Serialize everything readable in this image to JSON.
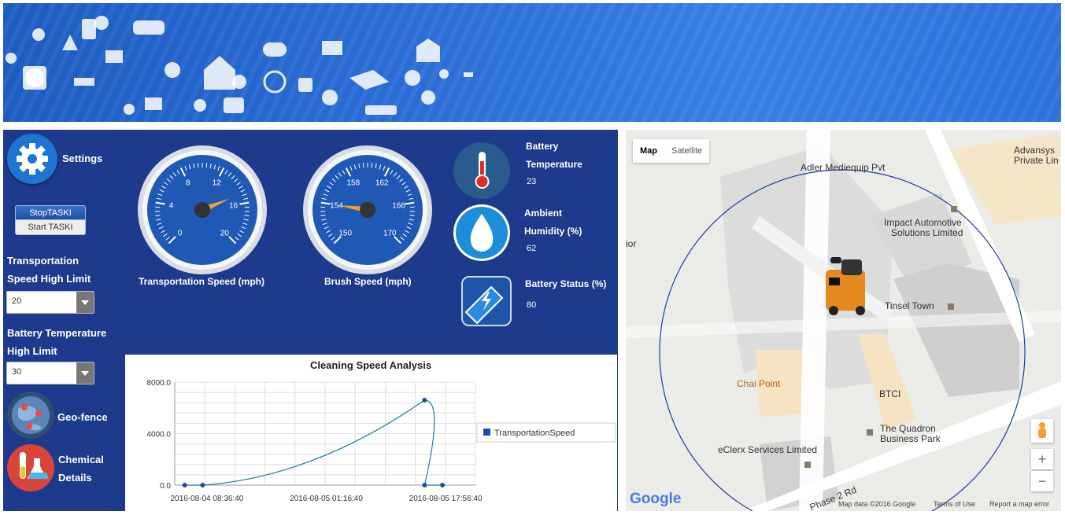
{
  "sidebar": {
    "settings_label": "Settings",
    "stop_task_label": "StopTASKI",
    "start_task_label": "Start TASKI",
    "transport_limit_label_1": "Transportation",
    "transport_limit_label_2": "Speed High Limit",
    "transport_limit_value": "20",
    "battery_limit_label_1": "Battery Temperature",
    "battery_limit_label_2": "High Limit",
    "battery_limit_value": "30",
    "geofence_label": "Geo-fence",
    "chemical_label_1": "Chemical",
    "chemical_label_2": "Details"
  },
  "gauges": [
    {
      "label": "Transportation Speed (mph)",
      "ticks": [
        "0",
        "4",
        "8",
        "12",
        "16",
        "20"
      ],
      "value": 15
    },
    {
      "label": "Brush Speed (mph)",
      "ticks": [
        "150",
        "154",
        "158",
        "162",
        "166",
        "170"
      ],
      "value": 154
    }
  ],
  "status": {
    "battery_temp_label_1": "Battery",
    "battery_temp_label_2": "Temperature",
    "battery_temp_value": "23",
    "humidity_label_1": "Ambient",
    "humidity_label_2": "Humidity (%)",
    "humidity_value": "62",
    "battery_status_label": "Battery Status (%)",
    "battery_status_value": "80"
  },
  "chart_data": {
    "type": "line",
    "title": "Cleaning Speed Analysis",
    "y_ticks": [
      "8000.0",
      "4000.0",
      "0.0"
    ],
    "ylim": [
      0,
      8000
    ],
    "x_ticks": [
      "2016-08-04 08:36:40",
      "2016-08-05 01:16:40",
      "2016-08-05 17:56:40"
    ],
    "series": [
      {
        "name": "TransportationSpeed",
        "x": [
          "2016-08-04 05:30:00",
          "2016-08-04 08:00:00",
          "2016-08-05 15:00:00",
          "2016-08-05 15:00:30",
          "2016-08-05 17:30:00"
        ],
        "values": [
          0,
          0,
          6600,
          0,
          0
        ]
      }
    ],
    "legend_position": "right",
    "grid": true
  },
  "map": {
    "tab_map": "Map",
    "tab_satellite": "Satellite",
    "places": [
      "Adler Mediequip Pvt",
      "Advansys",
      "Private Lin",
      "Impact Automotive",
      "Solutions Limited",
      "Tinsel Town",
      "Chai Point",
      "BTCI",
      "The Quadron",
      "Business Park",
      "eClerx Services Limited",
      "ior",
      "Phase 2 Rd"
    ],
    "logo": "Google",
    "footer_data": "Map data ©2016 Google",
    "footer_terms": "Terms of Use",
    "footer_report": "Report a map error",
    "zoom_in": "+",
    "zoom_out": "−"
  },
  "colors": {
    "panel": "#1e3a8c",
    "gauge_face": "#1f59b3",
    "needle": "#f0a030",
    "line": "#1f77c4"
  }
}
